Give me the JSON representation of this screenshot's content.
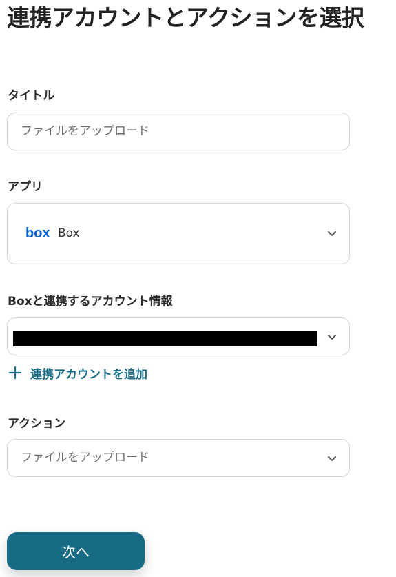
{
  "page": {
    "title": "連携アカウントとアクションを選択"
  },
  "form": {
    "title_field": {
      "label": "タイトル",
      "value": "ファイルをアップロード"
    },
    "app_field": {
      "label": "アプリ",
      "logo_text": "box",
      "value": "Box"
    },
    "account_field": {
      "label": "Boxと連携するアカウント情報",
      "value": ""
    },
    "add_account_label": "連携アカウントを追加",
    "action_field": {
      "label": "アクション",
      "value": "ファイルをアップロード"
    }
  },
  "footer": {
    "next_label": "次へ"
  },
  "colors": {
    "accent": "#176b85",
    "box_brand": "#0061d5",
    "border": "#d3d6da"
  },
  "icons": {
    "select_caret": "chevron-down-icon",
    "add": "plus-icon",
    "app_logo": "box-logo-icon"
  }
}
